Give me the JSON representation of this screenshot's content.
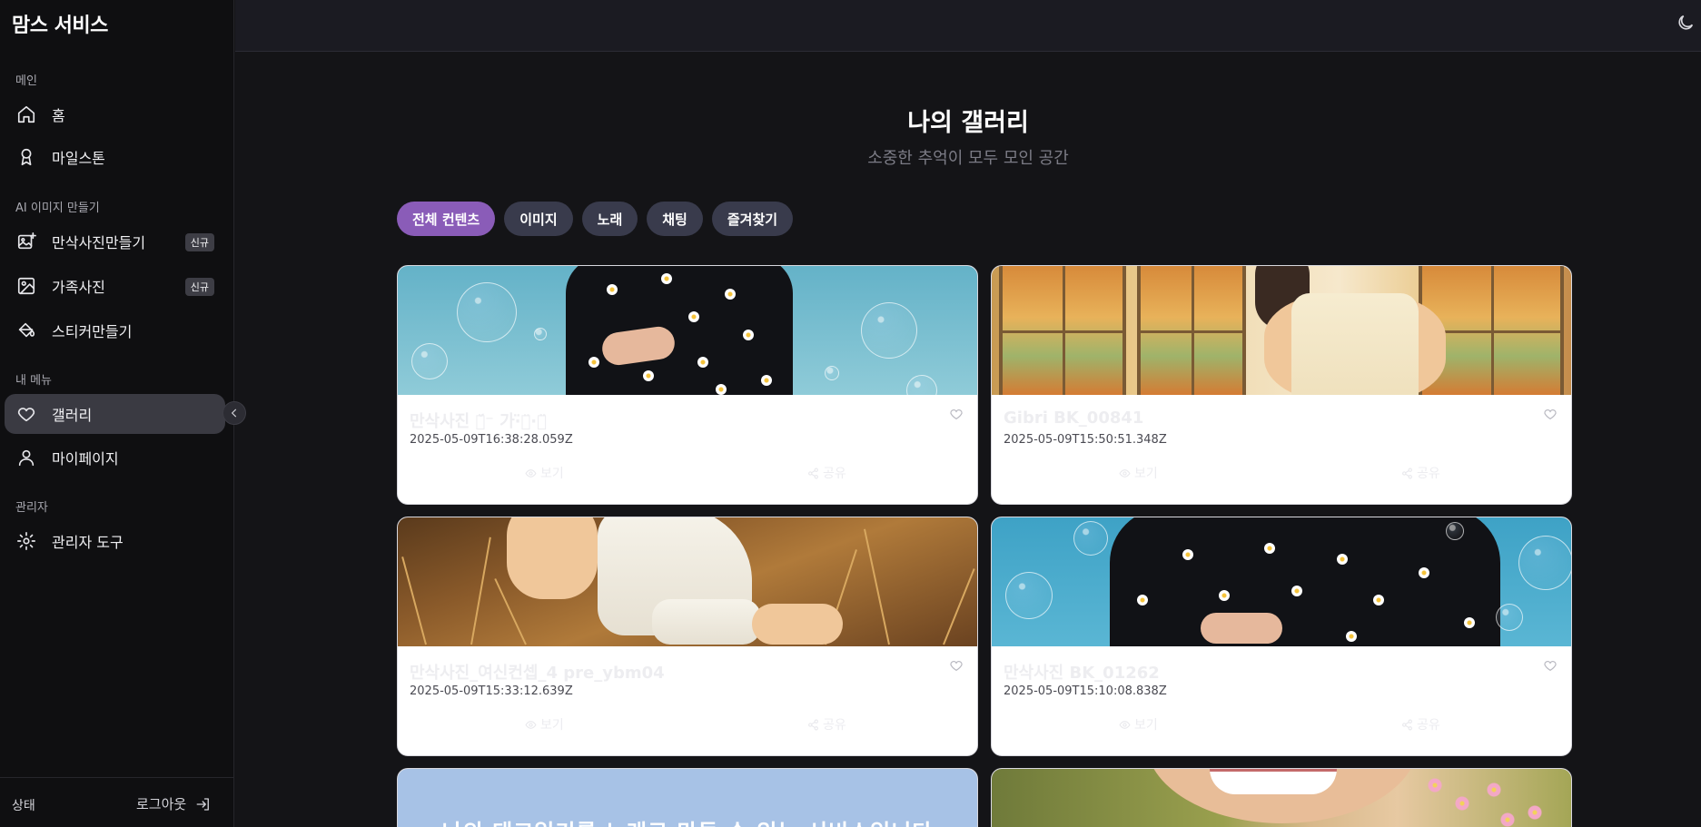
{
  "app": {
    "brand": "맘스 서비스"
  },
  "sidebar": {
    "sections": [
      {
        "label": "메인"
      },
      {
        "label": "AI 이미지 만들기"
      },
      {
        "label": "내 메뉴"
      },
      {
        "label": "관리자"
      }
    ],
    "items": [
      {
        "label": "홈",
        "icon": "home-icon"
      },
      {
        "label": "마일스톤",
        "icon": "award-icon"
      },
      {
        "label": "만삭사진만들기",
        "icon": "image-plus-icon",
        "badge": "신규"
      },
      {
        "label": "가족사진",
        "icon": "image-icon",
        "badge": "신규"
      },
      {
        "label": "스티커만들기",
        "icon": "paint-bucket-icon"
      },
      {
        "label": "갤러리",
        "icon": "heart-icon",
        "active": true
      },
      {
        "label": "마이페이지",
        "icon": "user-icon"
      },
      {
        "label": "관리자 도구",
        "icon": "gear-icon"
      }
    ],
    "footer": {
      "status": "상태",
      "logout": "로그아웃"
    }
  },
  "header": {
    "theme_icon": "moon-icon"
  },
  "gallery": {
    "title": "나의 갤러리",
    "subtitle": "소중한 추억이 모두 모인 공간",
    "tabs": [
      {
        "label": "전체 컨텐츠",
        "active": true
      },
      {
        "label": "이미지"
      },
      {
        "label": "노래"
      },
      {
        "label": "채팅"
      },
      {
        "label": "즐겨찾기"
      }
    ],
    "card_actions": {
      "view": "보기",
      "share": "공유"
    },
    "items": [
      {
        "title": "만삭사진 기̈́̈⁻ 가·̈̈이̈·이̈̈",
        "date": "2025-05-09T16:38:28.059Z"
      },
      {
        "title": "Gibri BK_00841",
        "date": "2025-05-09T15:50:51.348Z"
      },
      {
        "title": "만삭사진_여신컨셉_4 pre_ybm04",
        "date": "2025-05-09T15:33:12.639Z"
      },
      {
        "title": "만삭사진 BK_01262",
        "date": "2025-05-09T15:10:08.838Z"
      }
    ],
    "partial_thumb_text": "나의 태교일기를 노래로 만들 수 있는 서비스입니다"
  },
  "colors": {
    "accent": "#8a5cb8",
    "tab_bg": "#393b4c",
    "sidebar_bg": "#0f0f11",
    "main_bg": "#141417"
  }
}
